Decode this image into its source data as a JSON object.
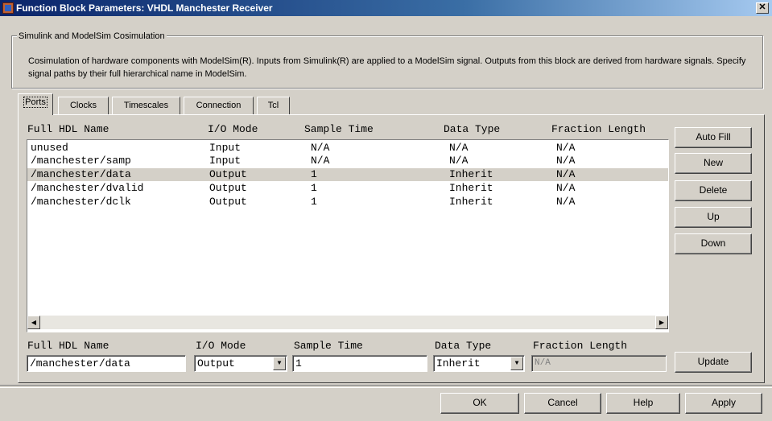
{
  "window": {
    "title": "Function Block Parameters: VHDL Manchester Receiver",
    "close_glyph": "✕"
  },
  "group": {
    "legend": "Simulink and ModelSim Cosimulation",
    "description": "Cosimulation of hardware components with ModelSim(R). Inputs from Simulink(R) are applied to a ModelSim signal. Outputs from this block are derived from hardware signals. Specify signal paths by their full hierarchical name in ModelSim."
  },
  "tabs": [
    {
      "label": "Ports",
      "active": true
    },
    {
      "label": "Clocks"
    },
    {
      "label": "Timescales"
    },
    {
      "label": "Connection"
    },
    {
      "label": "Tcl"
    }
  ],
  "table": {
    "columns": [
      "Full HDL Name",
      "I/O Mode",
      "Sample Time",
      "Data Type",
      "Fraction Length"
    ],
    "rows": [
      [
        "unused",
        "Input",
        "N/A",
        "N/A",
        "N/A"
      ],
      [
        "/manchester/samp",
        "Input",
        "N/A",
        "N/A",
        "N/A"
      ],
      [
        "/manchester/data",
        "Output",
        "1",
        "Inherit",
        "N/A"
      ],
      [
        "/manchester/dvalid",
        "Output",
        "1",
        "Inherit",
        "N/A"
      ],
      [
        "/manchester/dclk",
        "Output",
        "1",
        "Inherit",
        "N/A"
      ]
    ],
    "selected_row": 2
  },
  "side_buttons": {
    "auto_fill": "Auto Fill",
    "new": "New",
    "delete": "Delete",
    "up": "Up",
    "down": "Down",
    "update": "Update"
  },
  "editor": {
    "labels": {
      "name": "Full HDL Name",
      "io_mode": "I/O Mode",
      "sample_time": "Sample Time",
      "data_type": "Data Type",
      "fraction_length": "Fraction Length"
    },
    "name_value": "/manchester/data",
    "io_mode_value": "Output",
    "sample_time_value": "1",
    "data_type_value": "Inherit",
    "fraction_length_value": "N/A"
  },
  "footer": {
    "ok": "OK",
    "cancel": "Cancel",
    "help": "Help",
    "apply": "Apply"
  }
}
